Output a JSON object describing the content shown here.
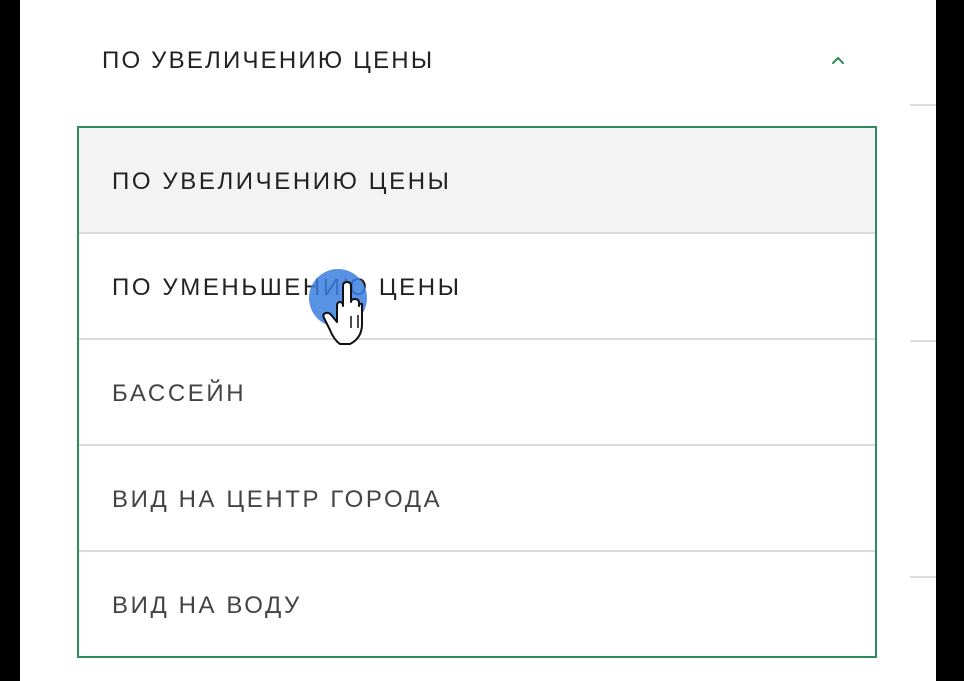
{
  "sort": {
    "current_label": "ПО УВЕЛИЧЕНИЮ ЦЕНЫ",
    "expanded": true,
    "toggle_icon": "chevron-up-icon",
    "accent_color": "#2e8b57",
    "options": [
      {
        "label": "ПО УВЕЛИЧЕНИЮ ЦЕНЫ",
        "state": "selected"
      },
      {
        "label": "ПО УМЕНЬШЕНИЮ ЦЕНЫ",
        "state": "hovered"
      },
      {
        "label": "БАССЕЙН",
        "state": "default"
      },
      {
        "label": "ВИД НА ЦЕНТР ГОРОДА",
        "state": "default"
      },
      {
        "label": "ВИД НА ВОДУ",
        "state": "default"
      }
    ]
  },
  "cursor": {
    "icon": "hand-pointer-icon",
    "highlight_color": "#3b7fe0"
  }
}
